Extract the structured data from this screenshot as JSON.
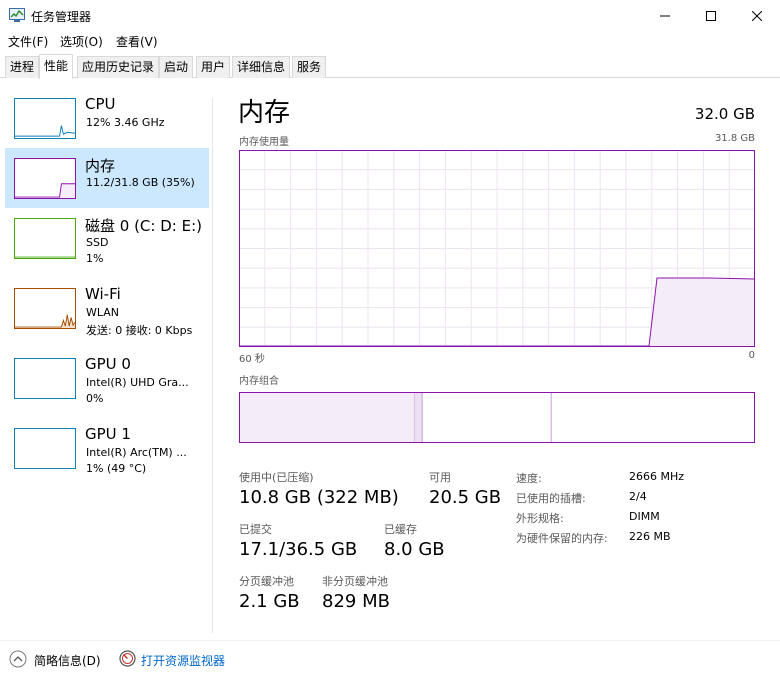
{
  "window": {
    "title": "任务管理器"
  },
  "menu": {
    "file": "文件(F)",
    "options": "选项(O)",
    "view": "查看(V)"
  },
  "tabs": [
    "进程",
    "性能",
    "应用历史记录",
    "启动",
    "用户",
    "详细信息",
    "服务"
  ],
  "sidebar": {
    "items": [
      {
        "name": "CPU",
        "line1": "12% 3.46 GHz",
        "line2": "",
        "color": "#117dbb"
      },
      {
        "name": "内存",
        "line1": "11.2/31.8 GB (35%)",
        "line2": "",
        "color": "#8b12ae"
      },
      {
        "name": "磁盘 0 (C: D: E:)",
        "line1": "SSD",
        "line2": "1%",
        "color": "#4da60c"
      },
      {
        "name": "Wi-Fi",
        "line1": "WLAN",
        "line2": "发送: 0 接收: 0 Kbps",
        "color": "#a74f01"
      },
      {
        "name": "GPU 0",
        "line1": "Intel(R) UHD Gra...",
        "line2": "0%",
        "color": "#117dbb"
      },
      {
        "name": "GPU 1",
        "line1": "Intel(R) Arc(TM) ...",
        "line2": "1% (49 °C)",
        "color": "#117dbb"
      }
    ]
  },
  "main": {
    "title": "内存",
    "total": "32.0 GB",
    "usage_label": "内存使用量",
    "usage_max": "31.8 GB",
    "axis_left": "60 秒",
    "axis_right": "0",
    "composition_label": "内存组合",
    "accent": "#8b12ae",
    "composition": {
      "in_use_fraction": 0.34,
      "modified_fraction": 0.015,
      "standby_fraction": 0.25
    },
    "usage_history_fraction": 0.35
  },
  "stats": {
    "in_use_label": "使用中(已压缩)",
    "in_use_value": "10.8 GB (322 MB)",
    "available_label": "可用",
    "available_value": "20.5 GB",
    "committed_label": "已提交",
    "committed_value": "17.1/36.5 GB",
    "cached_label": "已缓存",
    "cached_value": "8.0 GB",
    "paged_label": "分页缓冲池",
    "paged_value": "2.1 GB",
    "nonpaged_label": "非分页缓冲池",
    "nonpaged_value": "829 MB"
  },
  "specs": {
    "speed_label": "速度:",
    "speed_value": "2666 MHz",
    "slots_label": "已使用的插槽:",
    "slots_value": "2/4",
    "form_label": "外形规格:",
    "form_value": "DIMM",
    "reserved_label": "为硬件保留的内存:",
    "reserved_value": "226 MB"
  },
  "footer": {
    "fewer_details": "简略信息(D)",
    "open_monitor": "打开资源监视器"
  }
}
